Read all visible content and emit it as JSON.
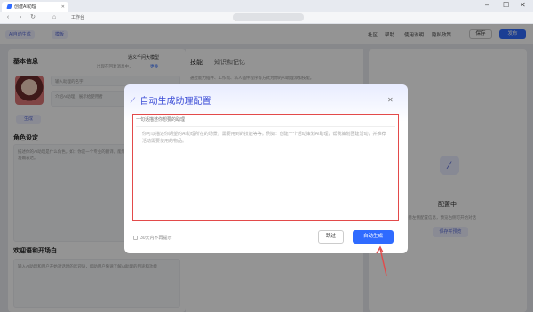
{
  "browser": {
    "tab_title": "创建AI助理",
    "workspace": "工作台"
  },
  "header": {
    "ai_button": "AI自动生成",
    "template_button": "模板",
    "nav": [
      "社区",
      "帮助",
      "使用说明",
      "隐私政策"
    ],
    "save": "保存",
    "publish": "发布"
  },
  "left": {
    "basic_info": "基本信息",
    "model": "通义千问大模型",
    "model_note": "出现在回复消息中，",
    "model_link": "更换",
    "name_ph": "输入助理的名字",
    "desc_ph": "介绍AI助理，展示给使用者",
    "gen_btn": "生成",
    "role_title": "角色设定",
    "role_ph": "描述你的AI助理是什么角色，如：你是一个专业的翻译，能够为用户将中文翻译为英文...并准确表达。",
    "welcome_title": "欢迎语和开场白",
    "welcome_ph": "输入AI助理和用户开始对话时的欢迎语，帮助用户快速了解AI助理的用途和功能"
  },
  "mid": {
    "tabs": [
      "技能",
      "知识和记忆"
    ],
    "note": "通过能力插件、工作流、私人插件程序等方式为你的AI助理添加技能。"
  },
  "right": {
    "status": "配置中",
    "note": "完善左侧配置信息，预览右侧可开始对话",
    "preview_btn": "保存并预览"
  },
  "dialog": {
    "title": "自动生成助理配置",
    "label": "一句话描述你想要的助理",
    "placeholder": "你可以描述你期望的AI助理所在的场景，需要用到的技能等等。例如：创建一个活动策划AI助理，帮我策划团建活动，并推荐活动需要使用的物品。",
    "dont_remind": "30天内不再提示",
    "skip": "跳过",
    "generate": "自动生成"
  },
  "colors": {
    "primary": "#2f6bff",
    "highlight": "#e34a4a",
    "title": "#3a4bd6"
  }
}
